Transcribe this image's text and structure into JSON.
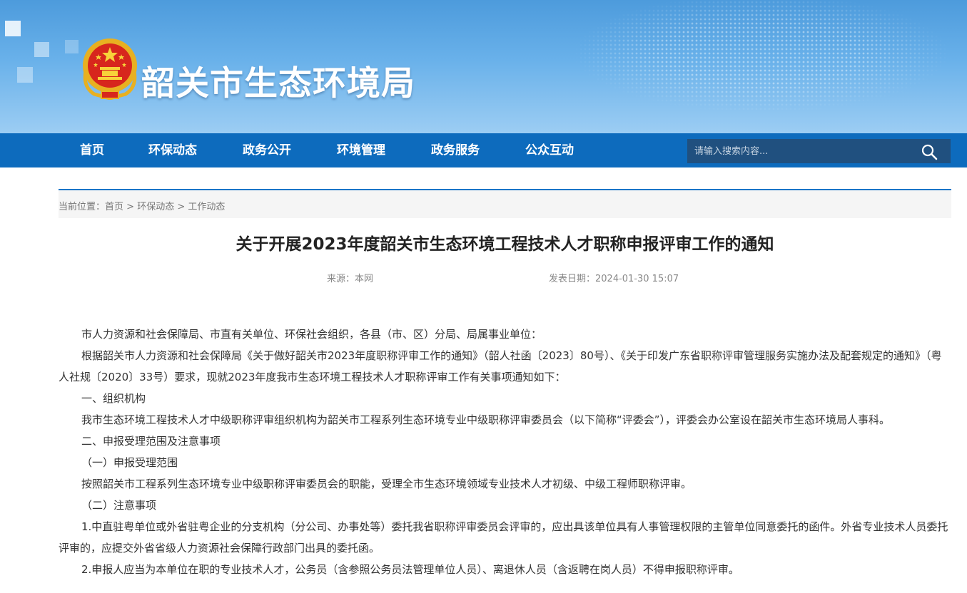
{
  "header": {
    "site_name": "韶关市生态环境局",
    "emblem_icon": "national-emblem-icon",
    "brand_color": "#0d6bbd"
  },
  "nav": {
    "items": [
      {
        "label": "首页"
      },
      {
        "label": "环保动态"
      },
      {
        "label": "政务公开"
      },
      {
        "label": "环境管理"
      },
      {
        "label": "政务服务"
      },
      {
        "label": "公众互动"
      }
    ],
    "search": {
      "placeholder": "请输入搜索内容...",
      "icon": "search-icon"
    }
  },
  "breadcrumb": {
    "prefix": "当前位置：",
    "items": [
      "首页",
      "环保动态",
      "工作动态"
    ],
    "separator": ">"
  },
  "article": {
    "title": "关于开展2023年度韶关市生态环境工程技术人才职称申报评审工作的通知",
    "source": "来源：本网",
    "date": "发表日期：2024-01-30 15:07",
    "paragraphs": [
      "市人力资源和社会保障局、市直有关单位、环保社会组织，各县（市、区）分局、局属事业单位：",
      "根据韶关市人力资源和社会保障局《关于做好韶关市2023年度职称评审工作的通知》（韶人社函〔2023〕80号）、《关于印发广东省职称评审管理服务实施办法及配套规定的通知》（粤人社规〔2020〕33号）要求，现就2023年度我市生态环境工程技术人才职称评审工作有关事项通知如下：",
      "一、组织机构",
      "我市生态环境工程技术人才中级职称评审组织机构为韶关市工程系列生态环境专业中级职称评审委员会（以下简称“评委会”），评委会办公室设在韶关市生态环境局人事科。",
      "二、申报受理范围及注意事项",
      "（一）申报受理范围",
      "按照韶关市工程系列生态环境专业中级职称评审委员会的职能，受理全市生态环境领域专业技术人才初级、中级工程师职称评审。",
      "（二）注意事项",
      "1.中直驻粤单位或外省驻粤企业的分支机构（分公司、办事处等）委托我省职称评审委员会评审的，应出具该单位具有人事管理权限的主管单位同意委托的函件。外省专业技术人员委托评审的，应提交外省省级人力资源社会保障行政部门出具的委托函。",
      "2.申报人应当为本单位在职的专业技术人才，公务员（含参照公务员法管理单位人员）、离退休人员（含返聘在岗人员）不得申报职称评审。"
    ]
  }
}
